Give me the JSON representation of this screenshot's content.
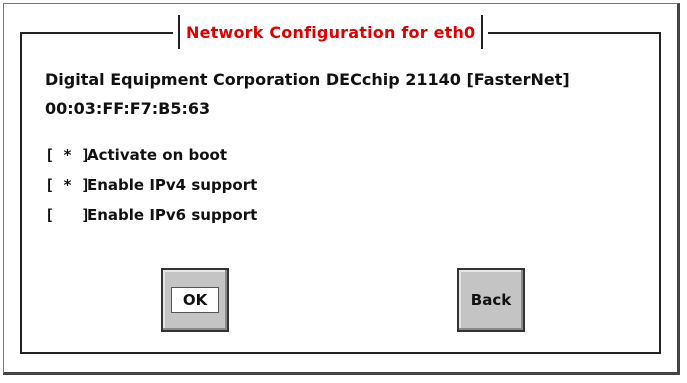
{
  "dialog": {
    "title": "Network Configuration for eth0",
    "device_name": "Digital Equipment Corporation DECchip 21140 [FasterNet]",
    "mac_address": "00:03:FF:F7:B5:63"
  },
  "options": [
    {
      "box": "[ * ]",
      "label": "Activate on boot",
      "checked": true
    },
    {
      "box": "[ * ]",
      "label": "Enable IPv4 support",
      "checked": true
    },
    {
      "box": "[   ]",
      "label": "Enable IPv6 support",
      "checked": false
    }
  ],
  "buttons": {
    "ok_label": "OK",
    "back_label": "Back"
  },
  "colors": {
    "title": "#e00000",
    "button_face": "#c4c4c4",
    "background": "#ffffff"
  }
}
